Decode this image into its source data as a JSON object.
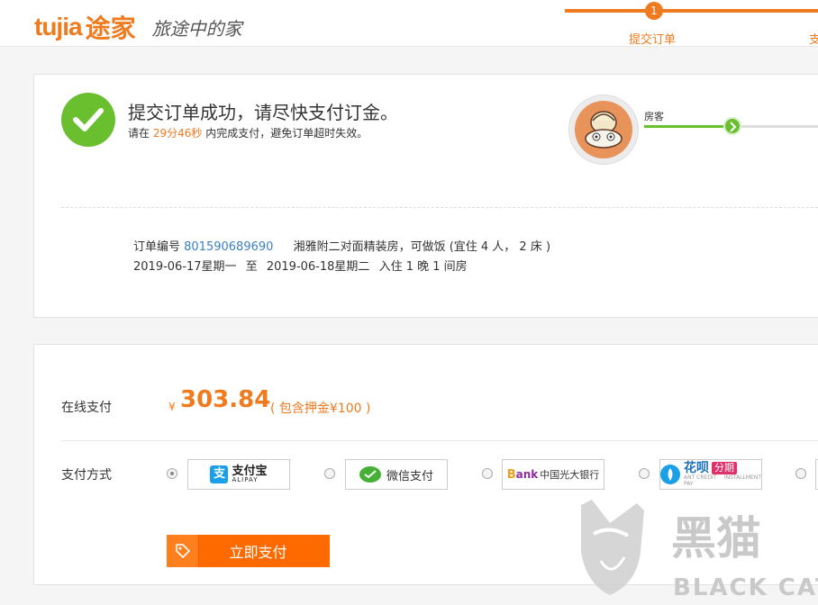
{
  "header": {
    "logo_en": "tujia",
    "logo_cn": "途家",
    "slogan": "旅途中的家",
    "steps": [
      {
        "number": "1",
        "label": "提交订单"
      },
      {
        "label": "支"
      }
    ]
  },
  "success": {
    "title": "提交订单成功，请尽快支付订金。",
    "sub_prefix": "请在 ",
    "countdown": "29分46秒",
    "sub_suffix": " 内完成支付，避免订单超时失效。"
  },
  "progress": {
    "guest_label": "房客"
  },
  "order": {
    "order_no_label": "订单编号",
    "order_no": "801590689690",
    "room_desc": "湘雅附二对面精装房，可做饭 (宜住 4 人， 2 床 )",
    "checkin": "2019-06-17星期一",
    "to": "至",
    "checkout": "2019-06-18星期二",
    "stay": "入住 1 晚 1 间房"
  },
  "payment": {
    "online_label": "在线支付",
    "currency": "¥",
    "amount": "303.84",
    "deposit": "( 包含押金¥100 )",
    "method_label": "支付方式",
    "methods": [
      {
        "name": "支付宝",
        "sub": "ALIPAY",
        "mark": "支",
        "selected": true
      },
      {
        "name": "微信支付",
        "selected": false
      },
      {
        "name_b": "B",
        "name_rest": "ank",
        "name_cn": "中国光大银行",
        "selected": false
      },
      {
        "name": "花呗",
        "tag": "分期",
        "sub": "ANT CREDIT PAY",
        "tag_sub": "INSTALLMENT",
        "selected": false
      },
      {
        "selected": false
      }
    ],
    "pay_button": "立即支付"
  },
  "watermark": {
    "cn": "黑猫",
    "en": "BLACK CAT"
  }
}
